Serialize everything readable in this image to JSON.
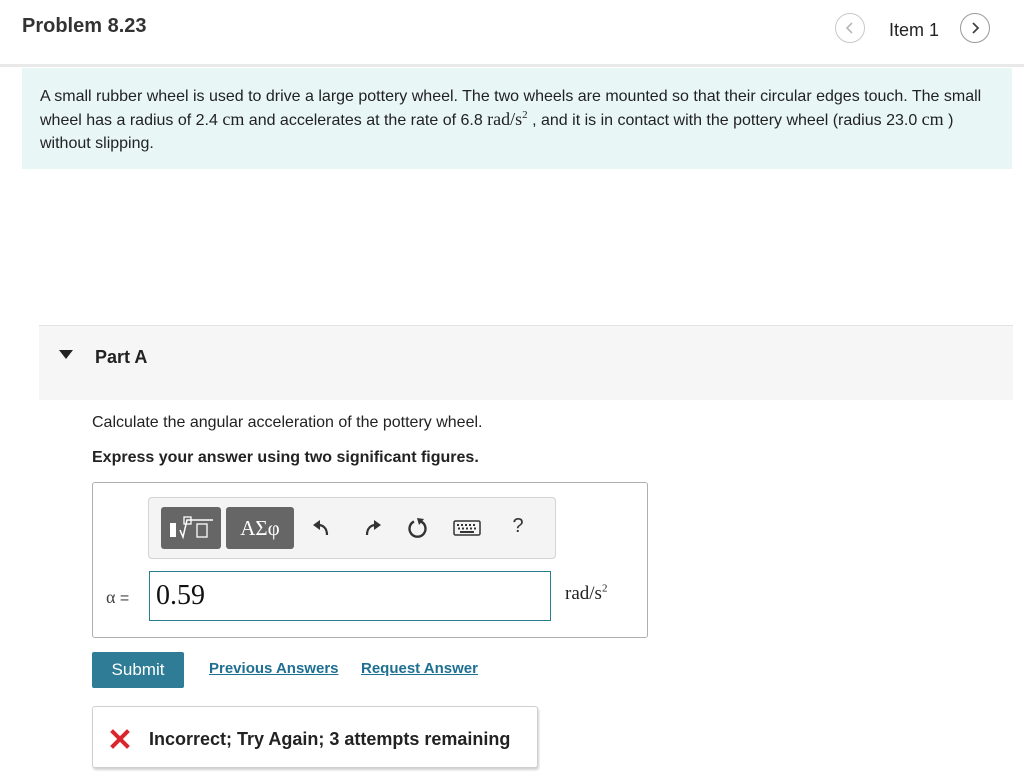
{
  "header": {
    "title": "Problem 8.23",
    "item_label": "Item 1",
    "prev_icon": "chevron-left-icon",
    "next_icon": "chevron-right-icon"
  },
  "intro": {
    "text_1": "A small rubber wheel is used to drive a large pottery wheel. The two wheels are mounted so that their circular edges touch. The small wheel has a radius of 2.4 ",
    "unit_cm_1": "cm",
    "text_2": " and accelerates at the rate of 6.8 ",
    "unit_rate": "rad/s",
    "unit_rate_exp": "2",
    "text_3": " , and it is in contact with the pottery wheel (radius 23.0 ",
    "unit_cm_2": "cm",
    "text_4": " ) without slipping."
  },
  "part": {
    "title": "Part A",
    "question": "Calculate the angular acceleration of the pottery wheel.",
    "instruction": "Express your answer using two significant figures."
  },
  "toolbar": {
    "symbols_label": "ΑΣφ",
    "help_label": "?",
    "icons": [
      "templates-icon",
      "undo-icon",
      "redo-icon",
      "reset-icon",
      "keyboard-icon",
      "help-icon"
    ]
  },
  "answer": {
    "variable": "α",
    "equals": "=",
    "value": "0.59",
    "unit": "rad/s",
    "unit_exp": "2"
  },
  "actions": {
    "submit_label": "Submit",
    "previous_answers_label": "Previous Answers",
    "request_answer_label": "Request Answer"
  },
  "feedback": {
    "text": "Incorrect; Try Again; 3 attempts remaining",
    "icon": "x-icon"
  },
  "colors": {
    "accent": "#2e7c96",
    "link": "#1f6f92",
    "intro_bg": "#e8f6f6",
    "error": "#d9262d"
  }
}
